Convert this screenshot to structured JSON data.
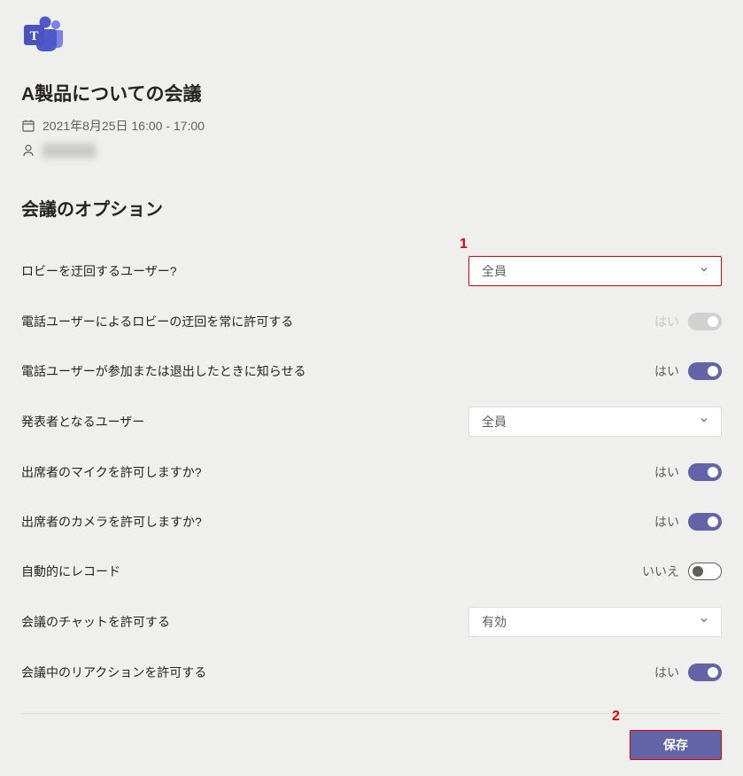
{
  "meeting": {
    "title": "A製品についての会議",
    "datetime": "2021年8月25日 16:00 - 17:00",
    "organizer": ""
  },
  "section_title": "会議のオプション",
  "options": {
    "lobby_bypass": {
      "label": "ロビーを迂回するユーザー?",
      "value": "全員"
    },
    "phone_bypass": {
      "label": "電話ユーザーによるロビーの迂回を常に許可する",
      "value_label": "はい",
      "on": true,
      "disabled": true
    },
    "announce_phone": {
      "label": "電話ユーザーが参加または退出したときに知らせる",
      "value_label": "はい",
      "on": true
    },
    "presenters": {
      "label": "発表者となるユーザー",
      "value": "全員"
    },
    "allow_mic": {
      "label": "出席者のマイクを許可しますか?",
      "value_label": "はい",
      "on": true
    },
    "allow_camera": {
      "label": "出席者のカメラを許可しますか?",
      "value_label": "はい",
      "on": true
    },
    "auto_record": {
      "label": "自動的にレコード",
      "value_label": "いいえ",
      "on": false
    },
    "allow_chat": {
      "label": "会議のチャットを許可する",
      "value": "有効"
    },
    "allow_reactions": {
      "label": "会議中のリアクションを許可する",
      "value_label": "はい",
      "on": true
    }
  },
  "annotations": {
    "one": "1",
    "two": "2"
  },
  "footer": {
    "save_label": "保存"
  }
}
